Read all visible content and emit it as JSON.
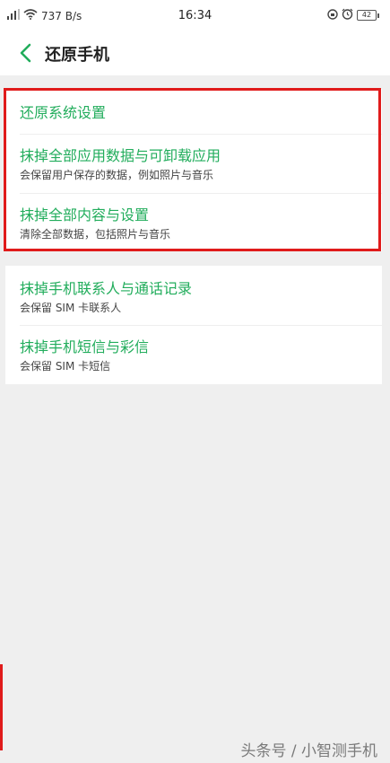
{
  "status_bar": {
    "network_speed": "737 B/s",
    "time": "16:34",
    "battery_level": "42",
    "signal_icon": "signal-icon",
    "wifi_icon": "wifi-icon",
    "alarm_icon": "alarm-icon",
    "lock_rotation_icon": "rotation-lock-icon"
  },
  "header": {
    "back_icon": "chevron-left-icon",
    "title": "还原手机"
  },
  "group_1": {
    "items": [
      {
        "title": "还原系统设置",
        "subtitle": ""
      },
      {
        "title": "抹掉全部应用数据与可卸载应用",
        "subtitle": "会保留用户保存的数据，例如照片与音乐"
      },
      {
        "title": "抹掉全部内容与设置",
        "subtitle": "清除全部数据，包括照片与音乐"
      }
    ]
  },
  "group_2": {
    "items": [
      {
        "title": "抹掉手机联系人与通话记录",
        "subtitle": "会保留 SIM 卡联系人"
      },
      {
        "title": "抹掉手机短信与彩信",
        "subtitle": "会保留 SIM 卡短信"
      }
    ]
  },
  "watermark": "头条号 / 小智测手机",
  "colors": {
    "accent": "#22ad5c",
    "highlight": "#e01b1b",
    "background": "#efefef"
  }
}
